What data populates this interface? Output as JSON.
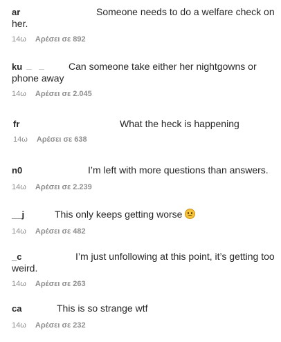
{
  "comments": [
    {
      "username": "ar",
      "text_first": "Someone needs to do a welfare check on",
      "text_rest": "her.",
      "time": "14ω",
      "likes": "Αρέσει σε 892"
    },
    {
      "username": "ku",
      "text_first": "Can someone take either her nightgowns or",
      "text_rest": "phone away",
      "time": "14ω",
      "likes": "Αρέσει σε 2.045"
    },
    {
      "username": "fr",
      "text_first": "What the heck is happening",
      "text_rest": "",
      "time": "14ω",
      "likes": "Αρέσει σε 638"
    },
    {
      "username": "n0",
      "text_first": "I’m left with more questions than answers.",
      "text_rest": "",
      "time": "14ω",
      "likes": "Αρέσει σε 2.239"
    },
    {
      "username": "__j",
      "text_first": "This only keeps getting worse",
      "text_rest": "",
      "time": "14ω",
      "likes": "Αρέσει σε 482",
      "emoji": "sad-face-emoji"
    },
    {
      "username": "_c",
      "text_first": "I’m just unfollowing at this point, it’s getting too",
      "text_rest": "weird.",
      "time": "14ω",
      "likes": "Αρέσει σε 263"
    },
    {
      "username": "ca",
      "text_first": "This is so strange wtf",
      "text_rest": "",
      "time": "14ω",
      "likes": "Αρέσει σε 232"
    }
  ]
}
